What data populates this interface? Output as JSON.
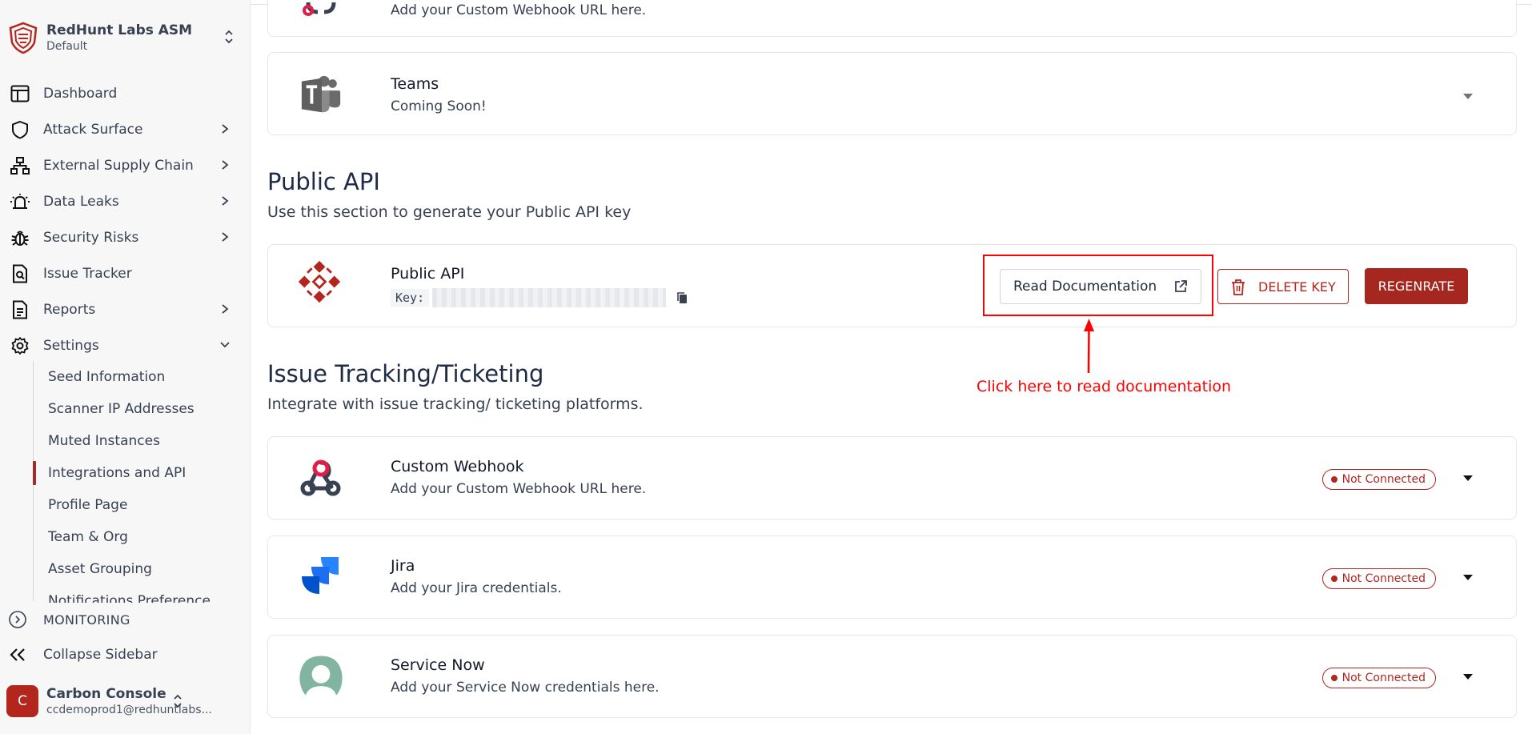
{
  "sidebar": {
    "org": {
      "name": "RedHunt Labs ASM",
      "workspace": "Default",
      "logo": "redhunt-shield-logo"
    },
    "nav": [
      {
        "label": "Dashboard",
        "icon": "dashboard-icon",
        "has_children": false
      },
      {
        "label": "Attack Surface",
        "icon": "shield-icon",
        "has_children": true
      },
      {
        "label": "External Supply Chain",
        "icon": "network-icon",
        "has_children": true
      },
      {
        "label": "Data Leaks",
        "icon": "siren-icon",
        "has_children": true
      },
      {
        "label": "Security Risks",
        "icon": "bug-icon",
        "has_children": true
      },
      {
        "label": "Issue Tracker",
        "icon": "file-search-icon",
        "has_children": false
      },
      {
        "label": "Reports",
        "icon": "document-icon",
        "has_children": true
      },
      {
        "label": "Settings",
        "icon": "gear-icon",
        "has_children": true,
        "expanded": true
      }
    ],
    "settings_sub": [
      "Seed Information",
      "Scanner IP Addresses",
      "Muted Instances",
      "Integrations and API",
      "Profile Page",
      "Team & Org",
      "Asset Grouping",
      "Notifications Preference"
    ],
    "active_sub": "Integrations and API",
    "monitoring_label": "MONITORING",
    "collapse_label": "Collapse Sidebar",
    "user": {
      "initial": "C",
      "name": "Carbon Console",
      "email": "ccdemoprod1@redhuntlabs..."
    }
  },
  "main": {
    "top_card": {
      "desc": "Add your Custom Webhook URL here."
    },
    "teams_card": {
      "title": "Teams",
      "desc": "Coming Soon!",
      "icon": "teams-icon"
    },
    "public_api_section": {
      "title": "Public API",
      "subtitle": "Use this section to generate your Public API key",
      "card": {
        "title": "Public API",
        "key_label": "Key:",
        "icon": "public-api-logo",
        "read_doc_label": "Read Documentation",
        "delete_label": "DELETE KEY",
        "regenerate_label": "REGENRATE"
      }
    },
    "annotation": {
      "text": "Click here to read documentation",
      "color": "#ff0000"
    },
    "issue_section": {
      "title": "Issue Tracking/Ticketing",
      "subtitle": "Integrate with issue tracking/ ticketing platforms.",
      "integrations": [
        {
          "title": "Custom Webhook",
          "desc": "Add your Custom Webhook URL here.",
          "status": "Not Connected",
          "icon": "webhook-icon"
        },
        {
          "title": "Jira",
          "desc": "Add your Jira credentials.",
          "status": "Not Connected",
          "icon": "jira-icon"
        },
        {
          "title": "Service Now",
          "desc": "Add your Service Now credentials here.",
          "status": "Not Connected",
          "icon": "servicenow-icon"
        }
      ]
    }
  },
  "colors": {
    "brand_red": "#a5271f",
    "status_red": "#b3261e",
    "annotation_red": "#ff0000"
  }
}
